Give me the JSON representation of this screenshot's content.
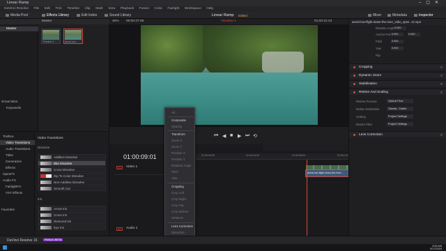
{
  "window": {
    "title": "Linear Ramp"
  },
  "menu": [
    "DaVinci Resolve",
    "File",
    "Edit",
    "Trim",
    "Timeline",
    "Clip",
    "Mark",
    "View",
    "Playback",
    "Fusion",
    "Color",
    "Fairlight",
    "Workspace",
    "Help"
  ],
  "toolbar": {
    "media_pool": "Media Pool",
    "effects_library": "Effects Library",
    "edit_index": "Edit Index",
    "sound_library": "Sound Library",
    "project_title": "Linear Ramp",
    "edited": "Edited",
    "mixer": "Mixer",
    "metadata": "Metadata",
    "inspector": "Inspector"
  },
  "media_pool": {
    "bin_label": "Master",
    "bins": [
      "Master"
    ],
    "smart_bins": "Smart Bins",
    "keywords": "Keywords",
    "clips": [
      {
        "name": "Timeline 1"
      },
      {
        "name": "aerial-low..."
      }
    ]
  },
  "effects": {
    "tree": [
      "Toolbox",
      "Video Transitions",
      "Audio Transitions",
      "Titles",
      "Generators",
      "Effects",
      "OpenFX",
      "Audio FX",
      "FairlightFX",
      "VST Effects"
    ],
    "favorites": "Favorites",
    "header": "Video Transitions",
    "group_dissolve": "Dissolve",
    "dissolve_items": [
      "Additive Dissolve",
      "Blur Dissolve",
      "Cross Dissolve",
      "Dip To Color Dissolve",
      "Non-Additive Dissolve",
      "Smooth Cut"
    ],
    "group_iris": "Iris",
    "iris_items": [
      "Arrow Iris",
      "Cross Iris",
      "Diamond Iris",
      "Eye Iris"
    ]
  },
  "viewer": {
    "zoom": "40%",
    "source_tc": "00:00:27:06",
    "timeline_name": "Timeline 1",
    "record_tc": "01:00:21:23"
  },
  "timeline": {
    "timecode": "01:00:09:01",
    "ruler": [
      "01:00:00:00",
      "01:00:04:00",
      "01:00:08:00",
      "01:00:12:00",
      "01:00:16:00"
    ],
    "tracks": [
      {
        "tag": "V1",
        "name": "Video 1"
      },
      {
        "tag": "A1",
        "name": "Audio 1",
        "level": "2.0"
      }
    ],
    "clip_label": "aerial-low-flight-down-the-river..."
  },
  "context_menu": {
    "items": [
      {
        "label": "All",
        "dim": true
      },
      {
        "label": "Composite",
        "dim": false
      },
      {
        "label": "Opacity",
        "dim": true
      },
      {
        "label": "Transform",
        "dim": false
      },
      {
        "label": "Zoom X",
        "dim": true
      },
      {
        "label": "Zoom Y",
        "dim": true
      },
      {
        "label": "Position X",
        "dim": true
      },
      {
        "label": "Position Y",
        "dim": true
      },
      {
        "label": "Rotation Angle",
        "dim": true
      },
      {
        "label": "Pitch",
        "dim": true
      },
      {
        "label": "Yaw",
        "dim": true
      },
      {
        "label": "Cropping",
        "dim": false
      },
      {
        "label": "Crop Left",
        "dim": true
      },
      {
        "label": "Crop Right",
        "dim": true
      },
      {
        "label": "Crop Top",
        "dim": true
      },
      {
        "label": "Crop Bottom",
        "dim": true
      },
      {
        "label": "Softness",
        "dim": true
      },
      {
        "label": "Lens Correction",
        "dim": false
      },
      {
        "label": "Distortion",
        "dim": true
      },
      {
        "label": "Retime Speed",
        "dim": false
      },
      {
        "label": "Retime Frame",
        "dim": false
      }
    ]
  },
  "inspector": {
    "clip_name": "aerial-low-flight-down-the-river_vidio_spee...D.mp4",
    "rows": [
      {
        "label": "Rotation Angle",
        "value": "0.000"
      },
      {
        "label": "Anchor Point",
        "value": "0.000"
      },
      {
        "label": "Pitch",
        "value": "0.000"
      },
      {
        "label": "Yaw",
        "value": "0.000"
      },
      {
        "label": "Flip",
        "value": ""
      }
    ],
    "sections": [
      "Cropping",
      "Dynamic Zoom",
      "Stabilization",
      "Retime And Scaling",
      "Lens Correction"
    ],
    "retime": [
      {
        "label": "Retime Process",
        "value": "Optical Flow"
      },
      {
        "label": "Motion Estimation",
        "value": "Standa...Faster"
      },
      {
        "label": "Scaling",
        "value": "Project Settings"
      },
      {
        "label": "Resize Filter",
        "value": "Project Settings"
      }
    ]
  },
  "status": {
    "app": "DaVinci Resolve 16",
    "beta": "PUBLIC BETA"
  },
  "taskbar": {
    "time": "3:05 AM",
    "date": "5/17/2019"
  },
  "colors": {
    "accent": "#d94c3a",
    "clip_blue": "#3b5b7b",
    "edited": "#e3a24a"
  }
}
